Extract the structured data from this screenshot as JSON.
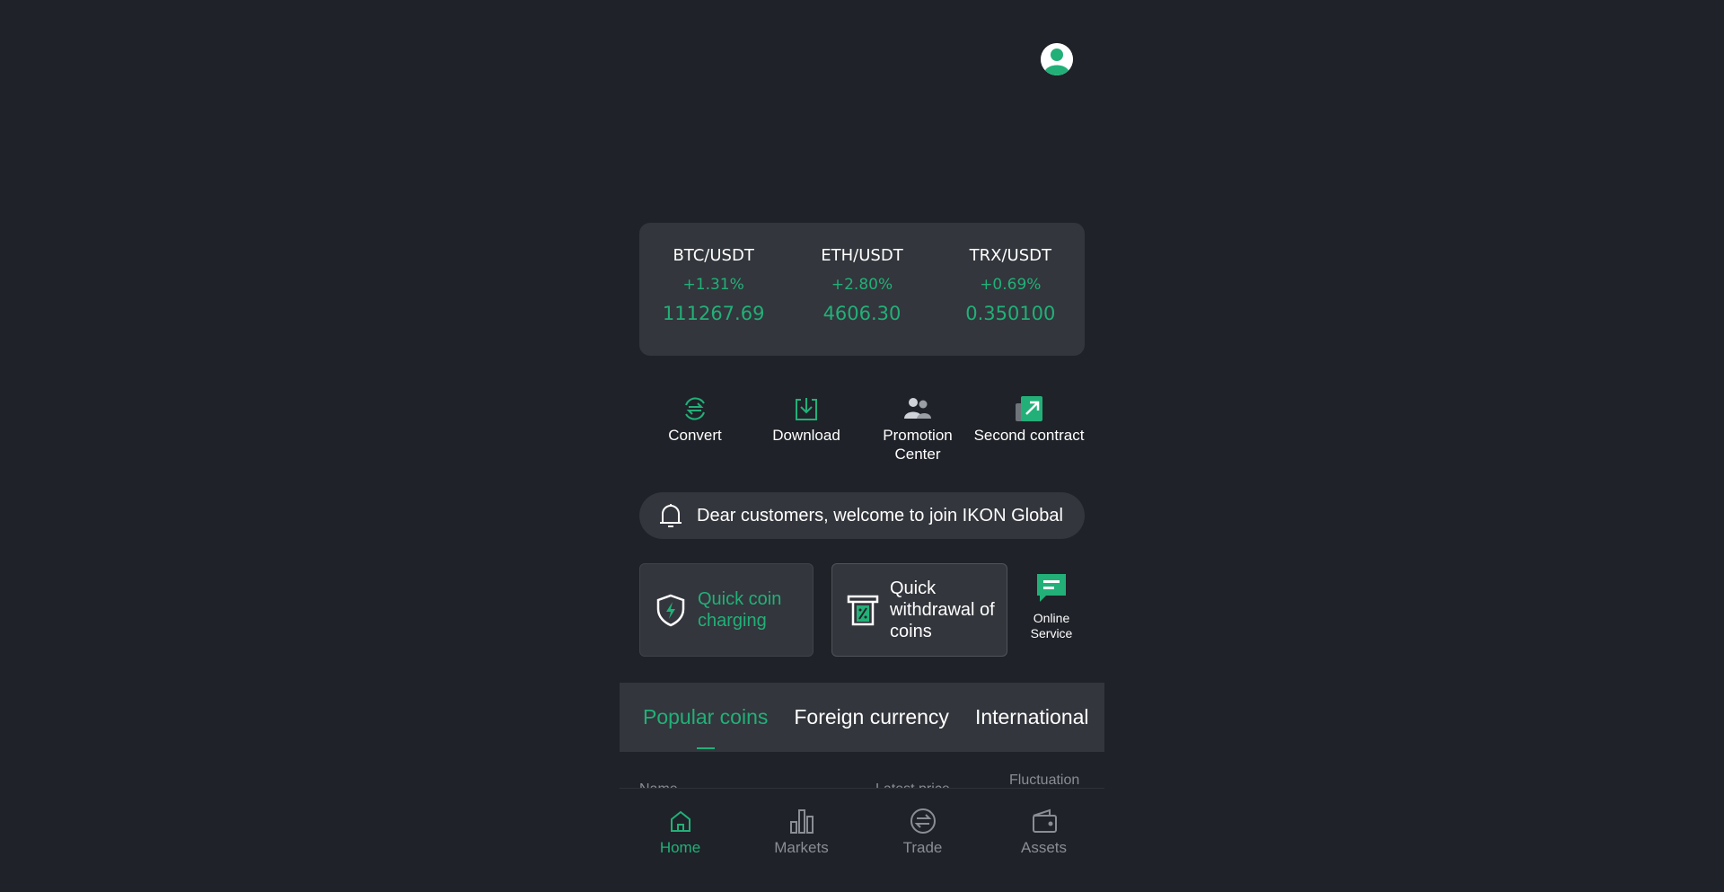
{
  "colors": {
    "background": "#1f2228",
    "card": "#33363c",
    "accent": "#22b078",
    "muted": "#8a8d93"
  },
  "header": {
    "avatar_icon": "user-avatar-icon"
  },
  "tickers": [
    {
      "pair": "BTC/USDT",
      "change": "+1.31%",
      "price": "111267.69"
    },
    {
      "pair": "ETH/USDT",
      "change": "+2.80%",
      "price": "4606.30"
    },
    {
      "pair": "TRX/USDT",
      "change": "+0.69%",
      "price": "0.350100"
    }
  ],
  "quick_links": [
    {
      "label": "Convert",
      "icon": "convert-icon"
    },
    {
      "label": "Download",
      "icon": "download-icon"
    },
    {
      "label": "Promotion Center",
      "icon": "users-icon"
    },
    {
      "label": "Second contract",
      "icon": "contract-icon"
    }
  ],
  "notice": {
    "text": "Dear customers, welcome to join IKON Global",
    "icon": "bell-icon"
  },
  "actions": {
    "charge": {
      "label": "Quick coin charging",
      "icon": "shield-bolt-icon"
    },
    "withdraw": {
      "label": "Quick withdrawal of coins",
      "icon": "atm-withdraw-icon"
    },
    "online": {
      "label": "Online Service",
      "icon": "chat-icon"
    }
  },
  "tabs": [
    {
      "label": "Popular coins",
      "active": true
    },
    {
      "label": "Foreign currency",
      "active": false
    },
    {
      "label": "International",
      "active": false
    }
  ],
  "table_header": {
    "name": "Name",
    "price": "Latest price",
    "fluctuation": "Fluctuation"
  },
  "bottom_nav": [
    {
      "label": "Home",
      "icon": "home-icon",
      "active": true
    },
    {
      "label": "Markets",
      "icon": "bar-chart-icon",
      "active": false
    },
    {
      "label": "Trade",
      "icon": "exchange-icon",
      "active": false
    },
    {
      "label": "Assets",
      "icon": "wallet-icon",
      "active": false
    }
  ]
}
